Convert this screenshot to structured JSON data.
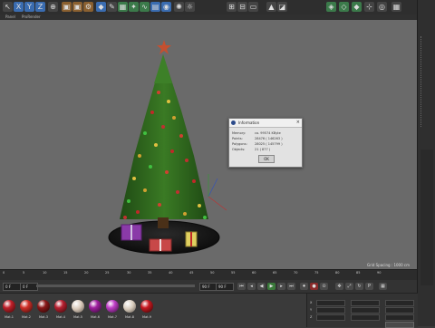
{
  "toolbar": {
    "buttons": [
      "X",
      "Y",
      "Z"
    ]
  },
  "view_menu": {
    "items": [
      "Panel",
      "ProRender"
    ]
  },
  "viewport": {
    "grid_spacing": "Grid Spacing : 1000 cm"
  },
  "dialog": {
    "title": "Information",
    "rows": [
      {
        "key": "Memory:",
        "value": "ca. 99574 KByte"
      },
      {
        "key": "Points:",
        "value": "28476 ( 146263 )"
      },
      {
        "key": "Polygons:",
        "value": "28025 ( 145799 )"
      },
      {
        "key": "Objects:",
        "value": "21 ( 877 )"
      }
    ],
    "ok_label": "OK",
    "close_label": "×"
  },
  "timeline": {
    "ticks": [
      "0",
      "5",
      "10",
      "15",
      "20",
      "25",
      "30",
      "35",
      "40",
      "45",
      "50",
      "55",
      "60",
      "65",
      "70",
      "75",
      "80",
      "85",
      "90"
    ],
    "start_frame": "0 F",
    "end_frame": "90 F",
    "current_frame": "0 F"
  },
  "materials": [
    {
      "label": "Mat.1",
      "color": "#c0202a"
    },
    {
      "label": "Mat.2",
      "color": "#d03028"
    },
    {
      "label": "Mat.3",
      "color": "#8a1818"
    },
    {
      "label": "Mat.4",
      "color": "#b82030"
    },
    {
      "label": "Mat.5",
      "color": "#d8c8b8"
    },
    {
      "label": "Mat.6",
      "color": "#a020a0"
    },
    {
      "label": "Mat.7",
      "color": "#c040c8"
    },
    {
      "label": "Mat.8",
      "color": "#d8ccbc"
    },
    {
      "label": "Mat.9",
      "color": "#c81820"
    }
  ],
  "coordinates": {
    "rows": [
      "X",
      "Y",
      "Z"
    ]
  }
}
